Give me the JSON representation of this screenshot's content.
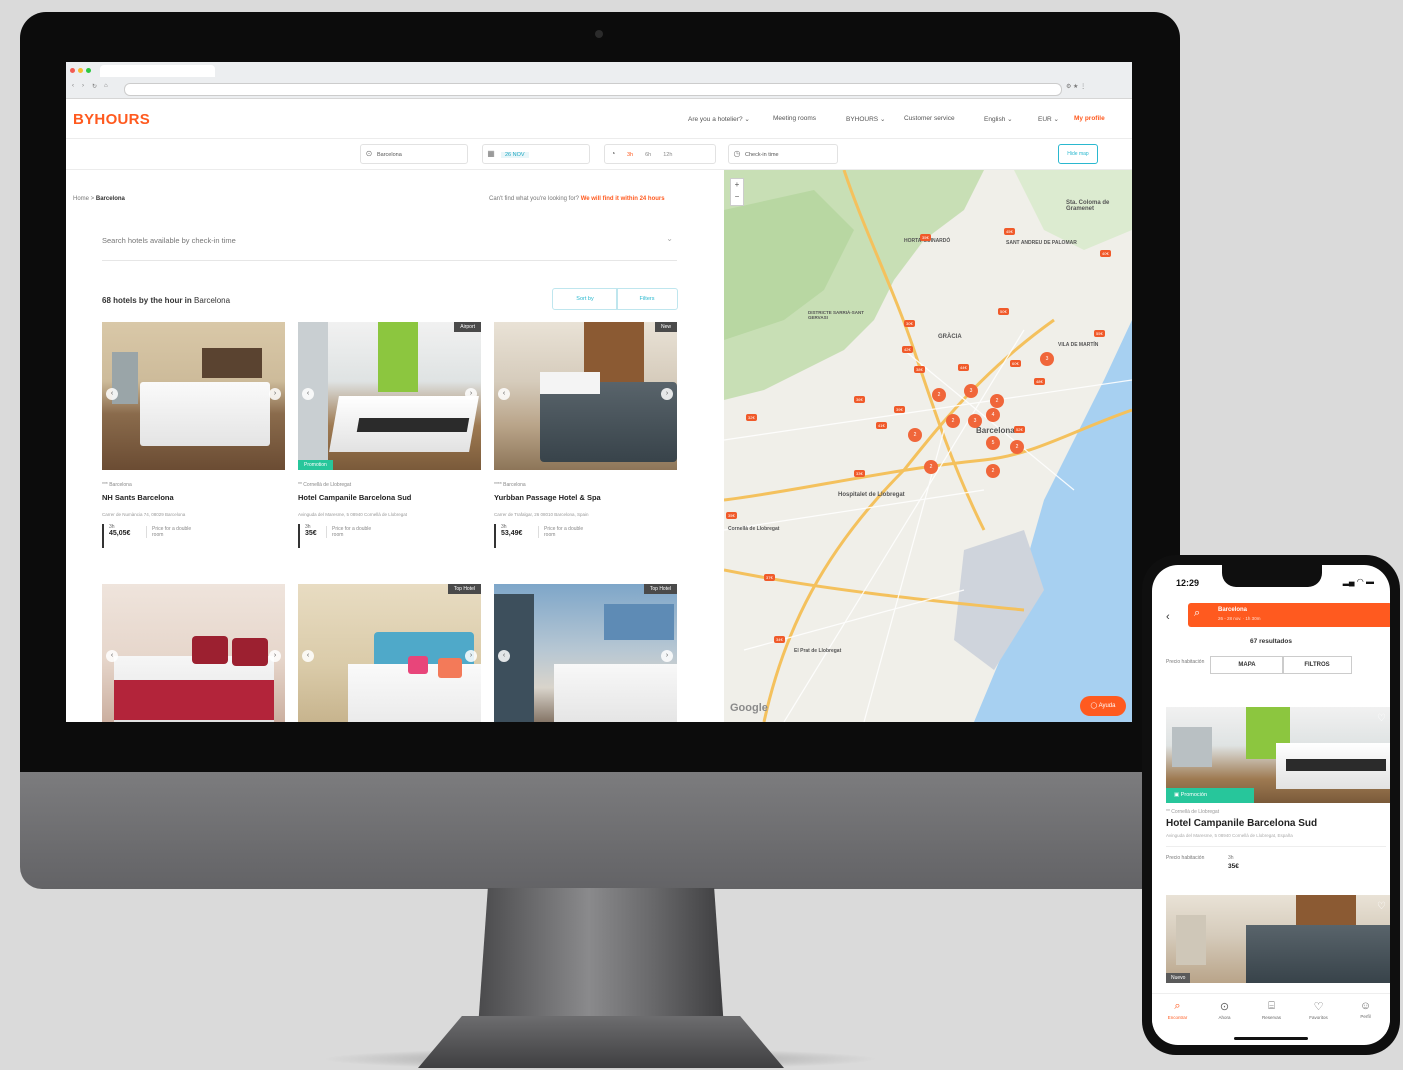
{
  "browser": {
    "tab_title": "",
    "url_text": ""
  },
  "header": {
    "logo": "BYHOURS",
    "links": [
      "Are you a hotelier? ⌄",
      "Meeting rooms",
      "BYHOURS ⌄",
      "Customer service",
      "English ⌄",
      "EUR ⌄"
    ],
    "profile": "My profile"
  },
  "search": {
    "city": "Barcelona",
    "date": "26 NOV",
    "hours": [
      "3h",
      "6h",
      "12h"
    ],
    "checkin_label": "Check-in time",
    "hide_map": "Hide map"
  },
  "results": {
    "breadcrumb_home": "Home >",
    "breadcrumb_city": "Barcelona",
    "cant_find": "Can't find what you're looking for?",
    "cant_find_link": "We will find it within 24 hours",
    "checkin_search": "Search hotels available by check-in time",
    "count_bold": "68 hotels by the hour in",
    "count_city": "Barcelona",
    "sort_label": "Sort by",
    "filter_label": "Filters",
    "hotels": [
      {
        "location": "*** Barcelona",
        "name": "NH Sants Barcelona",
        "address": "Carrer de Numància 74, 08029 Barcelona",
        "duration": "3h",
        "price": "45,05€",
        "note": "Price for a double room",
        "tag": "",
        "promo": ""
      },
      {
        "location": "** Cornellà de Llobregat",
        "name": "Hotel Campanile Barcelona Sud",
        "address": "Avinguda del Maresme, 5 08940 Cornellà de Llobregat",
        "duration": "3h",
        "price": "35€",
        "note": "Price for a double room",
        "tag": "Airport",
        "promo": "Promotion"
      },
      {
        "location": "**** Barcelona",
        "name": "Yurbban Passage Hotel & Spa",
        "address": "Carrer de Trafalgar, 26 08010 Barcelona, Spain",
        "duration": "3h",
        "price": "53,49€",
        "note": "Price for a double room",
        "tag": "New",
        "promo": ""
      },
      {
        "location": "",
        "name": "",
        "address": "",
        "duration": "",
        "price": "",
        "note": "",
        "tag": "",
        "promo": ""
      },
      {
        "location": "",
        "name": "",
        "address": "",
        "duration": "",
        "price": "",
        "note": "",
        "tag": "Top Hotel",
        "promo": ""
      },
      {
        "location": "",
        "name": "",
        "address": "",
        "duration": "",
        "price": "",
        "note": "",
        "tag": "Top Hotel",
        "promo": ""
      }
    ]
  },
  "map": {
    "labels": [
      "Sta. Coloma de Gramenet",
      "SANT ANDREU DE PALOMAR",
      "GRÀCIA",
      "Barcelona",
      "Hospitalet de Llobregat",
      "Cornellà de Llobregat",
      "El Prat de Llobregat",
      "HORTA-GUINARDÓ",
      "DISTRICTE SARRIÀ-SANT GERVASI",
      "VILA DE MARTÍN"
    ],
    "attribution": "Google",
    "help_button": "Ayuda"
  },
  "phone": {
    "time": "12:29",
    "city": "Barcelona",
    "dates": "26 - 28 nov. · 1h 30m",
    "results": "67 resultados",
    "price_label": "Precio habitación",
    "map_btn": "MAPA",
    "filters_btn": "FILTROS",
    "promo": "Promoción",
    "hotel_location": "** Cornellà de Llobregat",
    "hotel_name": "Hotel Campanile Barcelona Sud",
    "hotel_address": "Avinguda del Maresme, 5 08940 Cornellà de Llobregat, España",
    "duration": "3h",
    "price": "35€",
    "new_tag": "Nuevo",
    "tabs": [
      "Encontrar",
      "Ahora",
      "Reservas",
      "Favoritos",
      "Perfil"
    ]
  },
  "colors": {
    "brand": "#ff5a1f",
    "accent": "#2ab8cf",
    "promo": "#27c69b"
  }
}
